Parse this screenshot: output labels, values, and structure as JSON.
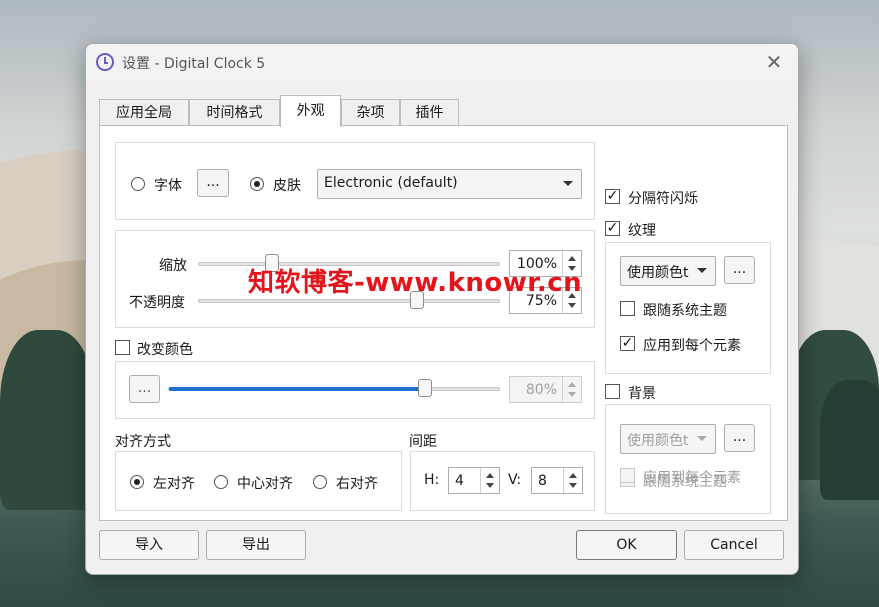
{
  "window": {
    "title": "设置 - Digital Clock 5"
  },
  "tabs": [
    {
      "label": "应用全局"
    },
    {
      "label": "时间格式"
    },
    {
      "label": "外观",
      "active": true
    },
    {
      "label": "杂项"
    },
    {
      "label": "插件"
    }
  ],
  "font_skin": {
    "font_label": "字体",
    "font_selected": false,
    "font_button": "...",
    "skin_label": "皮肤",
    "skin_selected": true,
    "skin_value": "Electronic (default)"
  },
  "zoom": {
    "label": "缩放",
    "value": "100%",
    "level": 0.25
  },
  "opacity": {
    "label": "不透明度",
    "value": "75%",
    "level": 0.75
  },
  "change_color": {
    "label": "改变颜色",
    "checked": false,
    "button": "...",
    "value": "80%",
    "level": 0.8
  },
  "alignment": {
    "label": "对齐方式",
    "options": [
      {
        "label": "左对齐",
        "selected": true
      },
      {
        "label": "中心对齐",
        "selected": false
      },
      {
        "label": "右对齐",
        "selected": false
      }
    ]
  },
  "spacing": {
    "label": "间距",
    "h_label": "H:",
    "h_value": "4",
    "v_label": "V:",
    "v_value": "8"
  },
  "separator_blink": {
    "label": "分隔符闪烁",
    "checked": true
  },
  "texture": {
    "label": "纹理",
    "checked": true,
    "combo_value": "使用颜色t",
    "button": "...",
    "follow_theme_label": "跟随系统主题",
    "follow_theme_checked": false,
    "apply_each_label": "应用到每个元素",
    "apply_each_checked": true
  },
  "background": {
    "label": "背景",
    "checked": false,
    "combo_value": "使用颜色t",
    "button": "...",
    "follow_theme_label": "跟随系统主题",
    "follow_theme_checked": false,
    "apply_each_label": "应用到每个元素",
    "apply_each_checked": false
  },
  "buttons": {
    "import": "导入",
    "export": "导出",
    "ok": "OK",
    "cancel": "Cancel"
  },
  "watermark": "知软博客-www.knowr.cn",
  "colors": {
    "accent": "#1f6fd1",
    "watermark": "#e3141b"
  }
}
